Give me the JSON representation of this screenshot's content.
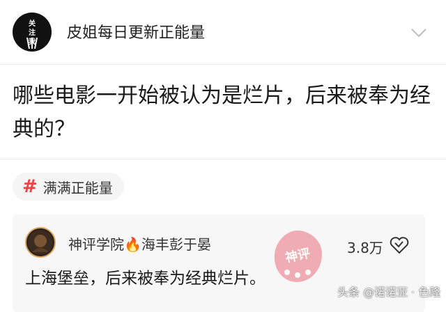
{
  "header": {
    "avatar_text": "关\n注\n我",
    "account_name": "皮姐每日更新正能量"
  },
  "question": {
    "title": "哪些电影一开始被认为是烂片，后来被奉为经典的？"
  },
  "tag": {
    "hash": "#",
    "label": "满满正能量"
  },
  "answer": {
    "author": "神评学院🔥海丰彭于晏",
    "count": "3.8万",
    "text": "上海堡垒，后来被奉为经典烂片。"
  },
  "watermark": {
    "text": "神评"
  },
  "source": {
    "text": "头条 @诺诺亚 · 色隆"
  },
  "colors": {
    "accent": "#f04142",
    "card_bg": "#f7f7f7",
    "tag_bg": "#f5f5f5",
    "watermark": "#e9707a"
  }
}
